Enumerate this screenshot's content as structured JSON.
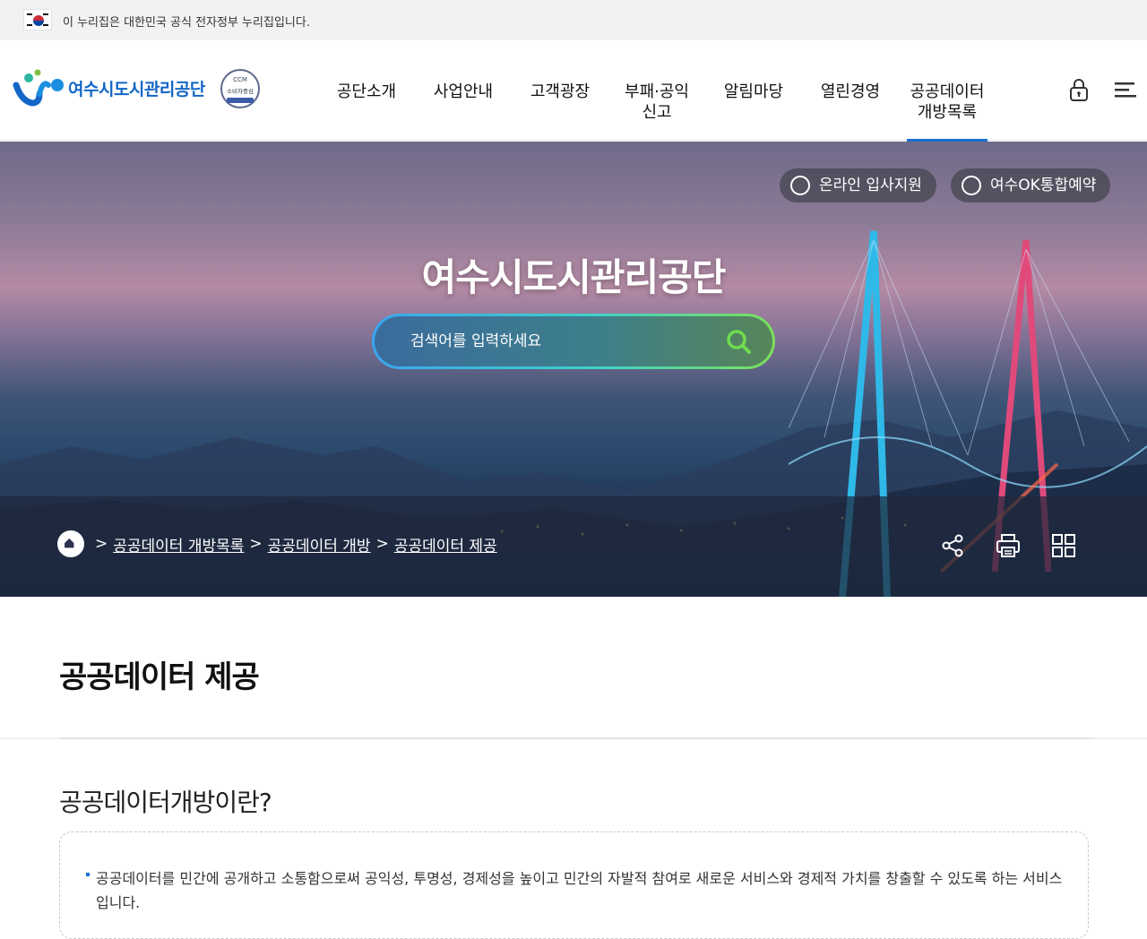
{
  "gov_banner": {
    "text": "이 누리집은 대한민국 공식 전자정부 누리집입니다."
  },
  "logo": {
    "name": "여수시도시관리공단",
    "badge_top": "CCM",
    "badge_text": "소비자중심"
  },
  "gnb": {
    "items": [
      {
        "label": "공단소개"
      },
      {
        "label": "사업안내"
      },
      {
        "label": "고객광장"
      },
      {
        "label": "부패·공익\n신고"
      },
      {
        "label": "알림마당"
      },
      {
        "label": "열린경영"
      },
      {
        "label": "공공데이터\n개방목록",
        "active": true
      }
    ]
  },
  "header_icons": [
    "lock-icon",
    "menu-icon"
  ],
  "hero": {
    "buttons": [
      {
        "label": "온라인 입사지원",
        "icon": "person-icon"
      },
      {
        "label": "여수OK통합예약",
        "icon": "share-arrow-icon"
      }
    ],
    "title": "여수시도시관리공단",
    "search": {
      "placeholder": "검색어를 입력하세요"
    }
  },
  "breadcrumb": {
    "items": [
      "공공데이터 개방목록",
      "공공데이터 개방",
      "공공데이터 제공"
    ],
    "separator": ">"
  },
  "utility_icons": [
    "share-icon",
    "print-icon",
    "sitemap-icon"
  ],
  "content": {
    "page_title": "공공데이터 제공",
    "section_title": "공공데이터개방이란?",
    "info_text": "공공데이터를 민간에 공개하고 소통함으로써 공익성, 투명성, 경제성을 높이고 민간의 자발적 참여로 새로운 서비스와 경제적 가치를 창출할 수 있도록 하는 서비스입니다."
  },
  "colors": {
    "accent": "#1a6fd4",
    "logo_blue": "#1366c7"
  }
}
